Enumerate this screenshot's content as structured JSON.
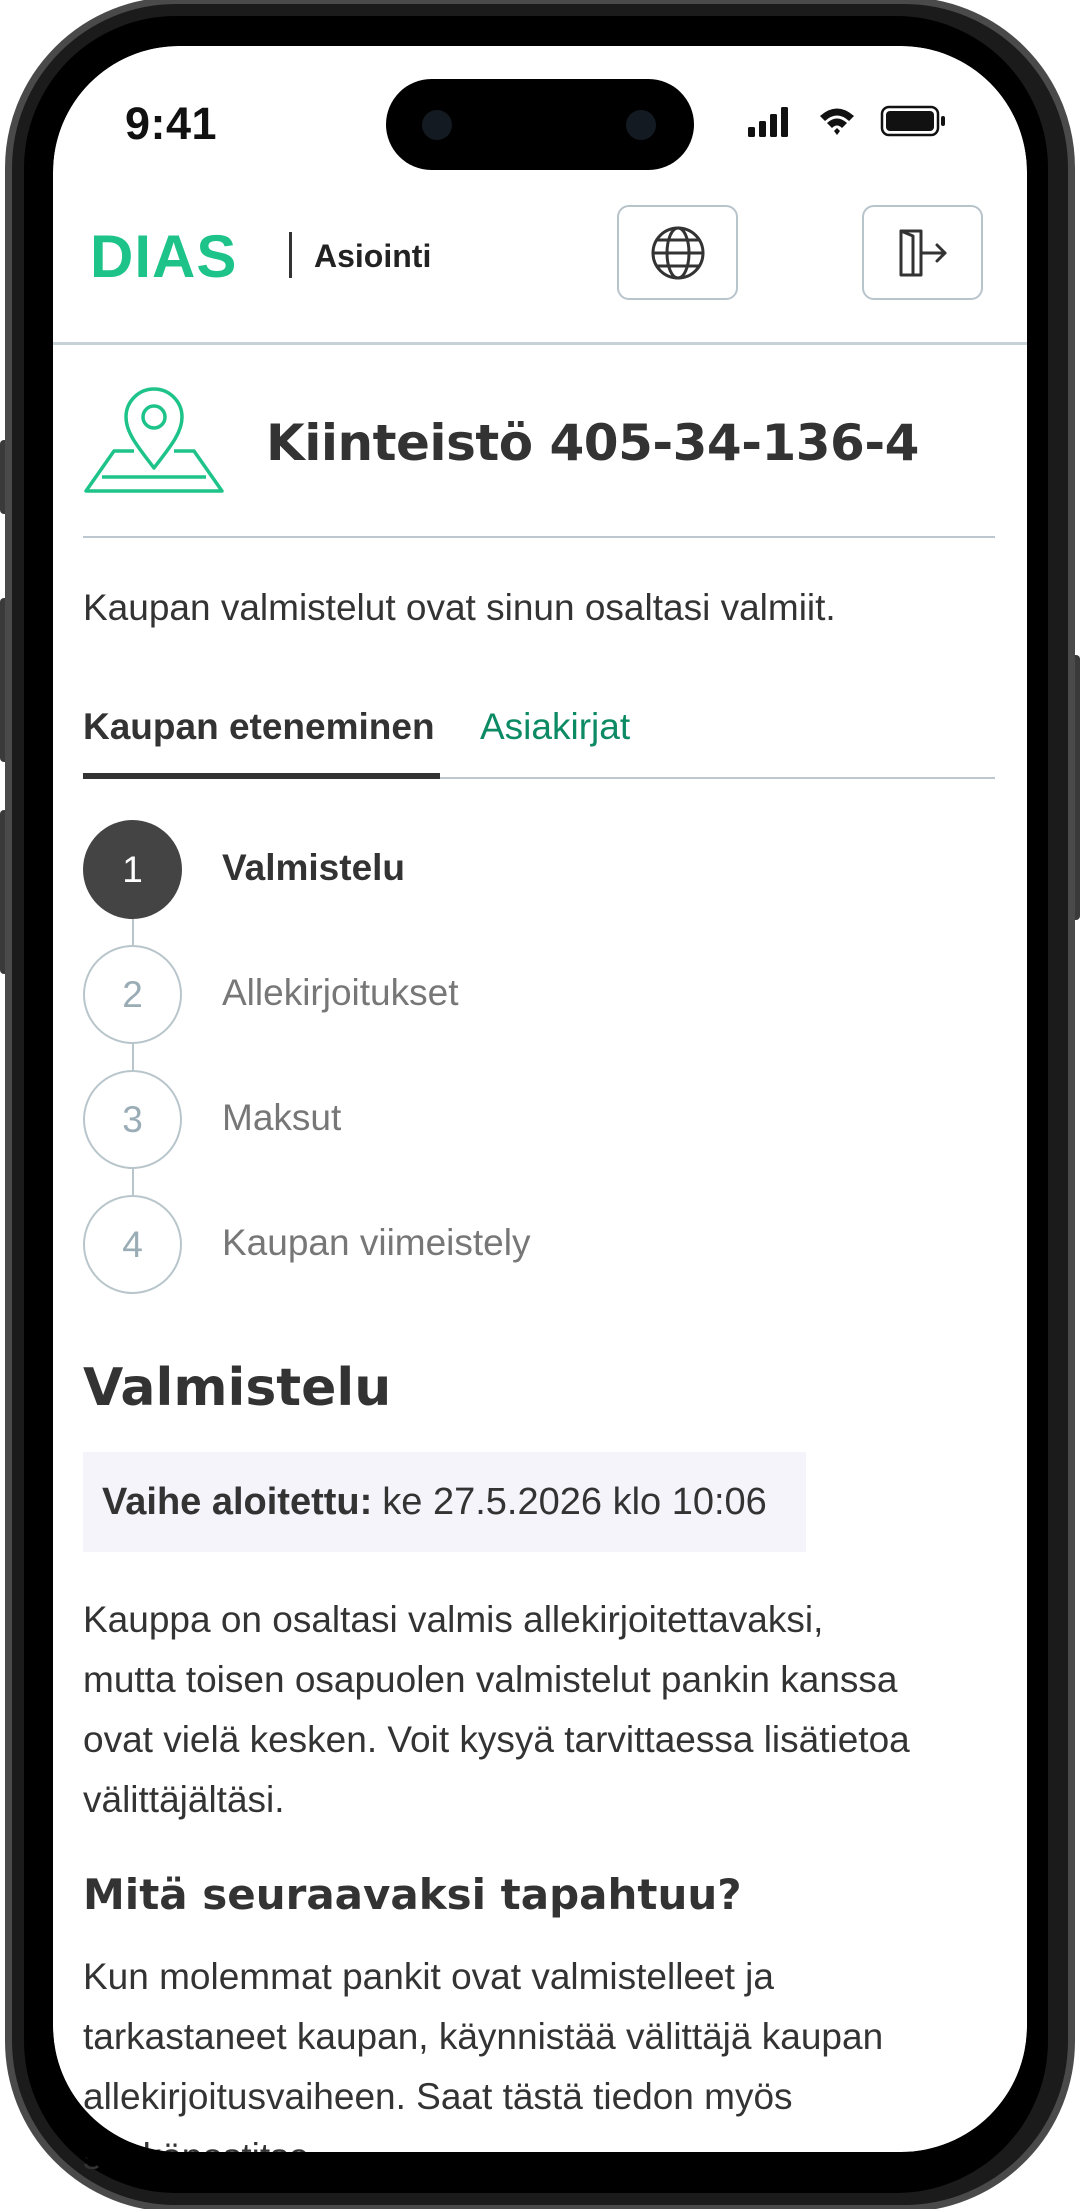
{
  "status_bar": {
    "time": "9:41"
  },
  "header": {
    "brand": "DIAS",
    "subtitle": "Asiointi",
    "language_icon": "globe-icon",
    "logout_icon": "logout-door-icon"
  },
  "property": {
    "icon": "location-pin-map-icon",
    "title": "Kiinteistö 405-34-136-4",
    "intro": "Kaupan valmistelut ovat sinun osaltasi valmiit."
  },
  "tabs": [
    {
      "label": "Kaupan eteneminen",
      "active": true
    },
    {
      "label": "Asiakirjat",
      "active": false
    }
  ],
  "steps": [
    {
      "number": "1",
      "label": "Valmistelu",
      "state": "active"
    },
    {
      "number": "2",
      "label": "Allekirjoitukset",
      "state": "pending"
    },
    {
      "number": "3",
      "label": "Maksut",
      "state": "pending"
    },
    {
      "number": "4",
      "label": "Kaupan viimeistely",
      "state": "pending"
    }
  ],
  "section": {
    "title": "Valmistelu",
    "phase_label": "Vaihe aloitettu:",
    "phase_value": "ke 27.5.2026 klo 10:06",
    "description_lines": [
      "Kauppa on osaltasi valmis allekirjoitettavaksi,",
      "mutta toisen osapuolen valmistelut pankin kanssa",
      "ovat vielä kesken. Voit kysyä tarvittaessa lisätietoa",
      "välittäjältäsi."
    ],
    "next_title": "Mitä seuraavaksi tapahtuu?",
    "next_lines": [
      "Kun molemmat pankit ovat valmistelleet ja",
      "tarkastaneet kaupan, käynnistää välittäjä kaupan",
      "allekirjoitusvaiheen. Saat tästä tiedon myös",
      "sähköpostitse."
    ]
  },
  "colors": {
    "brand_green": "#1ec38a",
    "tab_link_green": "#0b8a63",
    "text_dark": "#333333",
    "step_active": "#444444",
    "divider": "#bcc7cf",
    "phase_box_bg": "#f5f4fb"
  }
}
